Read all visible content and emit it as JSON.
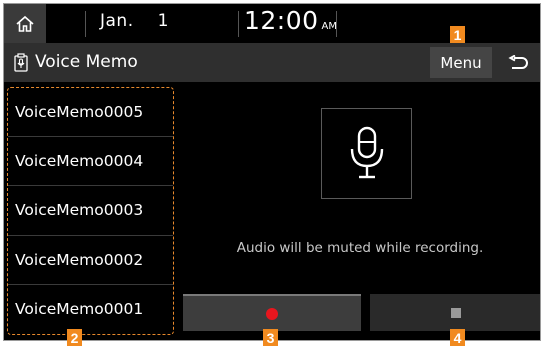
{
  "status": {
    "month": "Jan.",
    "day": "1",
    "time": "12:00",
    "ampm": "AM"
  },
  "header": {
    "title": "Voice Memo",
    "menu_label": "Menu"
  },
  "memos": [
    {
      "label": "VoiceMemo0005"
    },
    {
      "label": "VoiceMemo0004"
    },
    {
      "label": "VoiceMemo0003"
    },
    {
      "label": "VoiceMemo0002"
    },
    {
      "label": "VoiceMemo0001"
    }
  ],
  "main": {
    "notice": "Audio will be muted while recording."
  },
  "callouts": [
    "1",
    "2",
    "3",
    "4"
  ],
  "colors": {
    "callout": "#f18a1f",
    "record": "#e8161e"
  },
  "icons": {
    "home": "home-icon",
    "title": "voice-memo-icon",
    "back": "back-arrow-icon",
    "mic": "microphone-icon",
    "record": "record-dot-icon",
    "stop": "stop-square-icon"
  }
}
